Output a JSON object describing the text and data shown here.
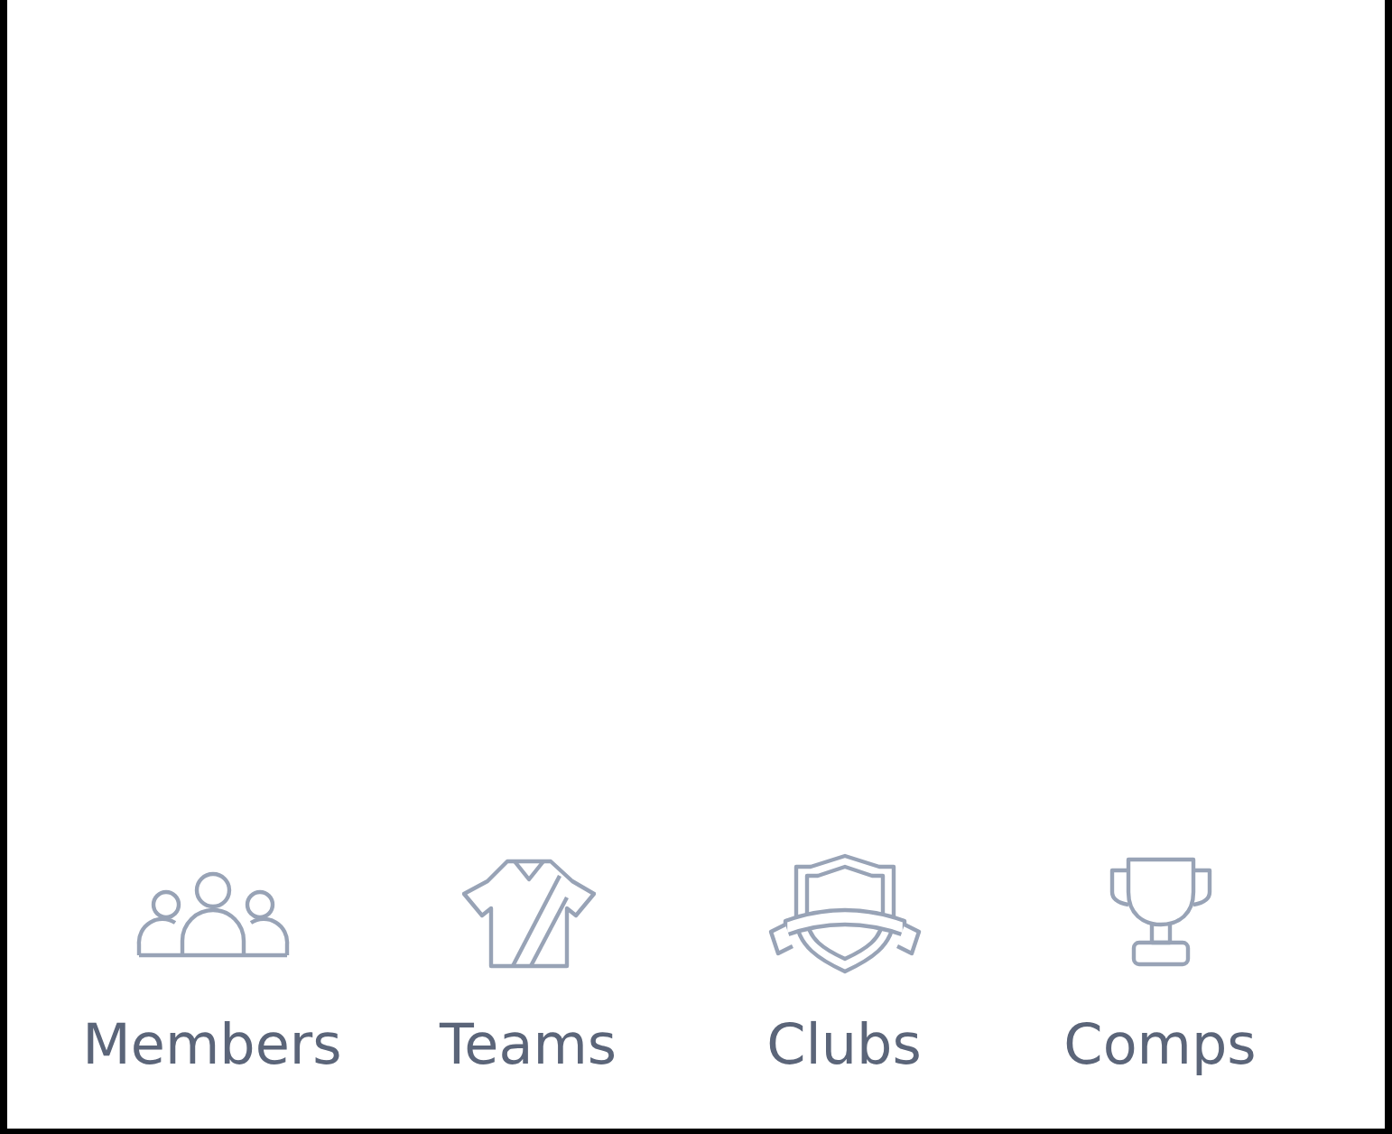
{
  "nav": [
    {
      "label": "Members"
    },
    {
      "label": "Teams"
    },
    {
      "label": "Clubs"
    },
    {
      "label": "Comps"
    }
  ]
}
